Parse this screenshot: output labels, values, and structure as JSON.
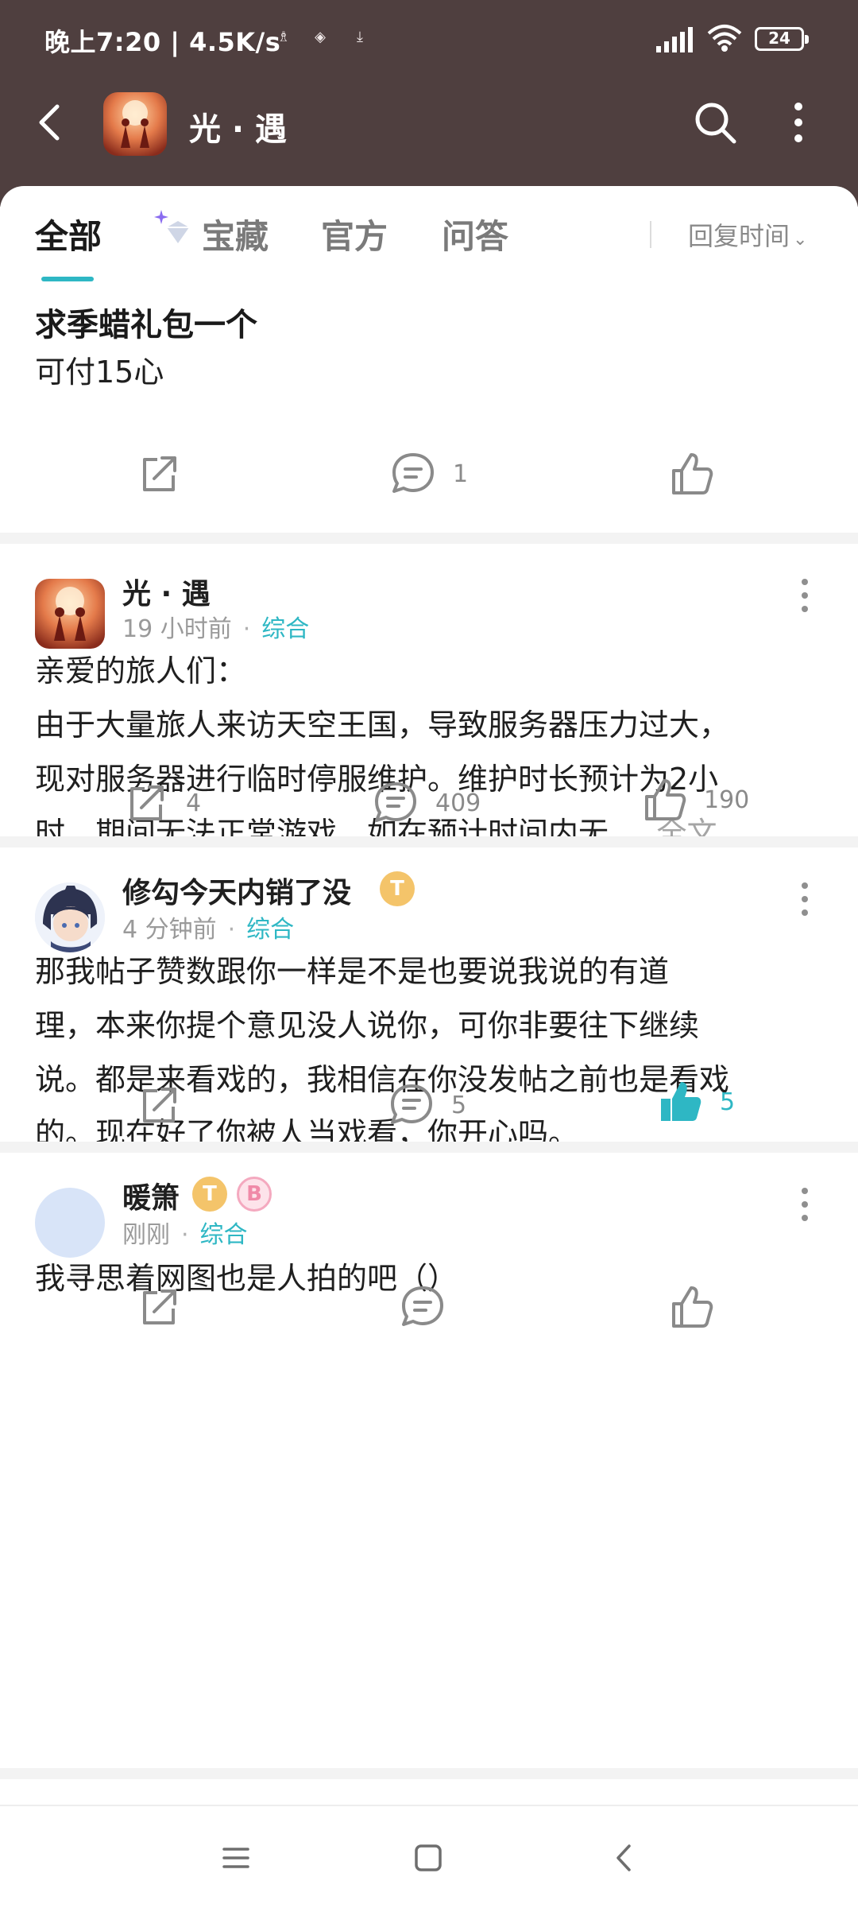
{
  "status_bar": {
    "time": "晚上7:20 | 4.5K/s",
    "battery": "24",
    "icons": [
      "ghost-icon",
      "shield-icon",
      "download-icon",
      "signal-icon",
      "wifi-icon",
      "battery-icon"
    ]
  },
  "header": {
    "title": "光 · 遇",
    "back_icon": "chevron-left-icon",
    "search_icon": "search-icon",
    "more_icon": "more-vertical-icon"
  },
  "tabs": {
    "items": [
      {
        "label": "全部",
        "active": true
      },
      {
        "label": "宝藏",
        "active": false,
        "icon": "sparkle-diamond-icon"
      },
      {
        "label": "官方",
        "active": false
      },
      {
        "label": "问答",
        "active": false
      }
    ],
    "sort_label": "回复时间"
  },
  "posts": [
    {
      "title": "求季蜡礼包一个",
      "body": "可付15心",
      "share": "",
      "comments": "1",
      "likes": ""
    },
    {
      "author": "光 · 遇",
      "time": "19 小时前",
      "category": "综合",
      "body_lines": [
        "亲爱的旅人们：",
        "由于大量旅人来访天空王国，导致服务器压力过大，",
        "现对服务器进行临时停服维护。维护时长预计为2小",
        "时，期间无法正常游戏，如在预计时间内无"
      ],
      "ellipsis": "...",
      "full_text": "全文",
      "share": "4",
      "comments": "409",
      "likes": "190"
    },
    {
      "author": "修勾今天内销了没",
      "badge": "T",
      "time": "4 分钟前",
      "category": "综合",
      "body_lines": [
        "那我帖子赞数跟你一样是不是也要说我说的有道",
        "理，本来你提个意见没人说你，可你非要往下继续",
        "说。都是来看戏的，我相信在你没发帖之前也是看戏",
        "的。现在好了你被人当戏看，你开心吗。"
      ],
      "share": "",
      "comments": "5",
      "likes": "5",
      "liked": true
    },
    {
      "author": "暖箫",
      "badges": [
        "T",
        "B"
      ],
      "time": "刚刚",
      "category": "综合",
      "body": "我寻思着网图也是人拍的吧（）",
      "share": "",
      "comments": "",
      "likes": ""
    }
  ],
  "colors": {
    "header_bg": "#4f3f3f",
    "accent": "#2eb7c4",
    "divider": "#f3f3f3"
  }
}
